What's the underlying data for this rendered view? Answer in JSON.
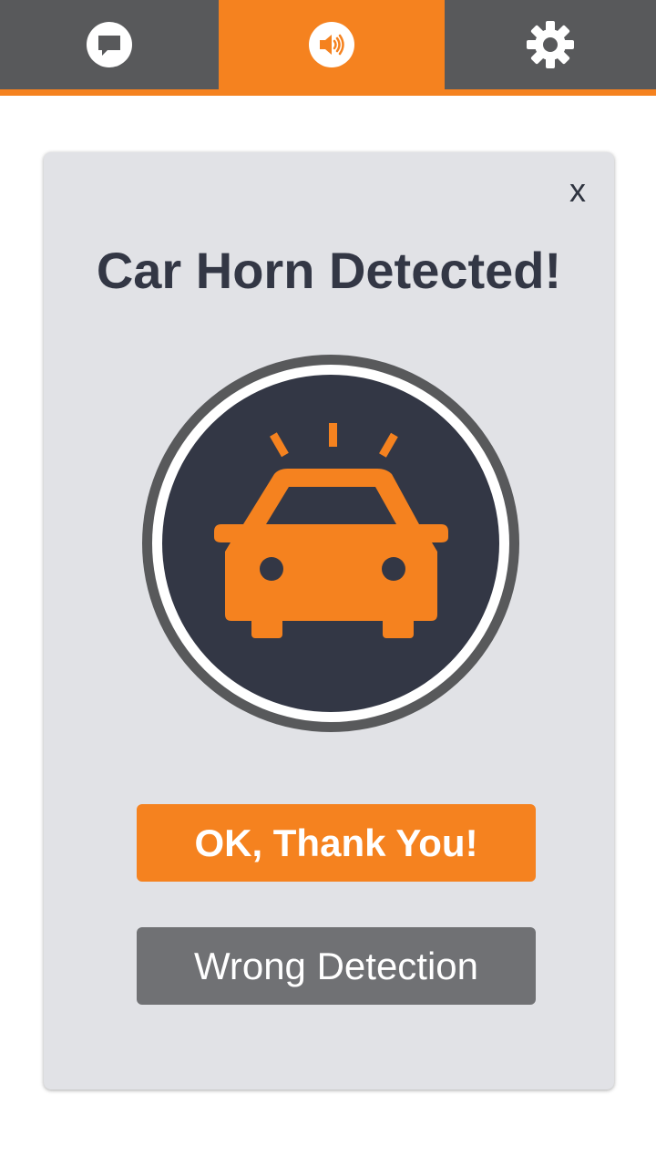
{
  "tabs": [
    {
      "icon": "chat-icon",
      "active": false
    },
    {
      "icon": "speaker-icon",
      "active": true
    },
    {
      "icon": "gear-icon",
      "active": false
    }
  ],
  "colors": {
    "accent": "#f5821f",
    "tab_inactive": "#58595b",
    "card_bg": "#e1e2e6",
    "title_text": "#333745",
    "circle_fill": "#333745",
    "secondary_button": "#707174"
  },
  "dialog": {
    "close_label": "x",
    "title": "Car Horn Detected!",
    "icon": "car-icon",
    "ok_label": "OK, Thank You!",
    "wrong_label": "Wrong Detection"
  }
}
